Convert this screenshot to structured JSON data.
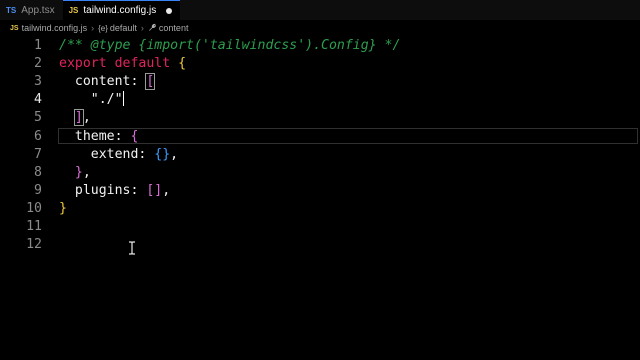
{
  "tabs": [
    {
      "lang": "TS",
      "label": "App.tsx",
      "active": false
    },
    {
      "lang": "JS",
      "label": "tailwind.config.js",
      "active": true
    }
  ],
  "breadcrumb": {
    "lang": "JS",
    "file": "tailwind.config.js",
    "symbol_module_glyph": "{e}",
    "symbol_default": "default",
    "symbol_content": "content"
  },
  "editor": {
    "line_numbers": [
      "1",
      "2",
      "3",
      "4",
      "5",
      "6",
      "7",
      "8",
      "9",
      "10",
      "11",
      "12"
    ],
    "current_line": 4,
    "lines": [
      [
        {
          "t": "/** ",
          "c": "comment"
        },
        {
          "t": "@type",
          "c": "comment"
        },
        {
          "t": " {import('tailwindcss').Config} */",
          "c": "comment"
        }
      ],
      [
        {
          "t": "export",
          "c": "keyword"
        },
        {
          "t": " ",
          "c": "punct"
        },
        {
          "t": "default",
          "c": "keyword"
        },
        {
          "t": " ",
          "c": "punct"
        },
        {
          "t": "{",
          "c": "bracket1"
        }
      ],
      [
        {
          "t": "  content: ",
          "c": "prop"
        },
        {
          "t": "[",
          "c": "bracket2",
          "hl": true
        }
      ],
      [
        {
          "t": "    \"./\"",
          "c": "string"
        }
      ],
      [
        {
          "t": "  ",
          "c": "punct"
        },
        {
          "t": "]",
          "c": "bracket2",
          "hl": true
        },
        {
          "t": ",",
          "c": "punct"
        }
      ],
      [
        {
          "t": "  theme: ",
          "c": "prop"
        },
        {
          "t": "{",
          "c": "bracket2"
        }
      ],
      [
        {
          "t": "    extend: ",
          "c": "prop"
        },
        {
          "t": "{}",
          "c": "bracket3"
        },
        {
          "t": ",",
          "c": "punct"
        }
      ],
      [
        {
          "t": "  ",
          "c": "punct"
        },
        {
          "t": "}",
          "c": "bracket2"
        },
        {
          "t": ",",
          "c": "punct"
        }
      ],
      [
        {
          "t": "  plugins: ",
          "c": "prop"
        },
        {
          "t": "[]",
          "c": "bracket2"
        },
        {
          "t": ",",
          "c": "punct"
        }
      ],
      [
        {
          "t": "}",
          "c": "bracket1"
        }
      ],
      [],
      []
    ]
  },
  "icons": {
    "dirty_indicator": "unsaved-dot-icon",
    "breadcrumb_module": "module-icon",
    "breadcrumb_property": "wrench-icon",
    "mouse_cursor": "text-ibeam-cursor-icon"
  },
  "colors": {
    "background": "#000000",
    "comment": "#2e9e4e",
    "keyword": "#e0245e",
    "bracket_gold": "#f0cd3c",
    "bracket_purple": "#da70d6",
    "bracket_blue": "#3b9cff",
    "ts_badge": "#4f8ff0",
    "js_badge": "#e8c84a"
  }
}
